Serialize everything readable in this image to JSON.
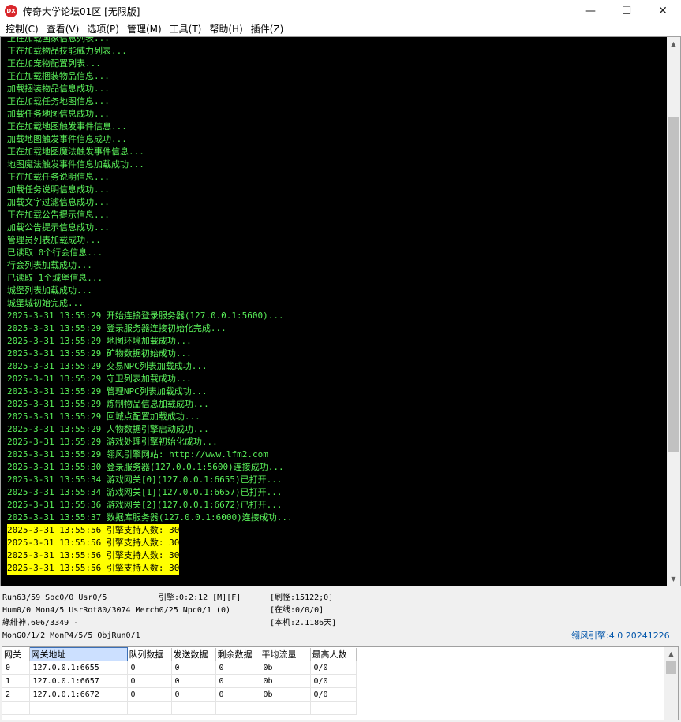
{
  "window": {
    "title": "传奇大学论坛01区 [无限版]",
    "icon_label": "DX",
    "minimize_glyph": "—",
    "maximize_glyph": "☐",
    "close_glyph": "✕"
  },
  "menu": [
    {
      "label": "控制(C)"
    },
    {
      "label": "查看(V)"
    },
    {
      "label": "选项(P)"
    },
    {
      "label": "管理(M)"
    },
    {
      "label": "工具(T)"
    },
    {
      "label": "帮助(H)"
    },
    {
      "label": "插件(Z)"
    }
  ],
  "console": {
    "text_color": "#5af25a",
    "highlight_color": "#ffff00",
    "scroll_position": 0.36,
    "lines": [
      {
        "text": "正在加载国家信息列表..."
      },
      {
        "text": "正在加载物品技能威力列表..."
      },
      {
        "text": "正在加宠物配置列表..."
      },
      {
        "text": "正在加载捆装物品信息..."
      },
      {
        "text": "加载捆装物品信息成功..."
      },
      {
        "text": "正在加载任务地图信息..."
      },
      {
        "text": "加载任务地图信息成功..."
      },
      {
        "text": "正在加载地图触发事件信息..."
      },
      {
        "text": "加载地图触发事件信息成功..."
      },
      {
        "text": "正在加载地图魔法触发事件信息..."
      },
      {
        "text": "地图魔法触发事件信息加载成功..."
      },
      {
        "text": "正在加载任务说明信息..."
      },
      {
        "text": "加载任务说明信息成功..."
      },
      {
        "text": "加载文字过滤信息成功..."
      },
      {
        "text": "正在加载公告提示信息..."
      },
      {
        "text": "加载公告提示信息成功..."
      },
      {
        "text": "管理员列表加载成功..."
      },
      {
        "text": "已读取 0个行会信息..."
      },
      {
        "text": "行会列表加载成功..."
      },
      {
        "text": "已读取 1个城堡信息..."
      },
      {
        "text": "城堡列表加载成功..."
      },
      {
        "text": "城堡城初始完成..."
      },
      {
        "text": "2025-3-31 13:55:29 开始连接登录服务器(127.0.0.1:5600)..."
      },
      {
        "text": "2025-3-31 13:55:29 登录服务器连接初始化完成..."
      },
      {
        "text": "2025-3-31 13:55:29 地图环境加载成功..."
      },
      {
        "text": "2025-3-31 13:55:29 矿物数据初始成功..."
      },
      {
        "text": "2025-3-31 13:55:29 交易NPC列表加载成功..."
      },
      {
        "text": "2025-3-31 13:55:29 守卫列表加载成功..."
      },
      {
        "text": "2025-3-31 13:55:29 管理NPC列表加载成功..."
      },
      {
        "text": "2025-3-31 13:55:29 炼制物品信息加载成功..."
      },
      {
        "text": "2025-3-31 13:55:29 回城点配置加载成功..."
      },
      {
        "text": "2025-3-31 13:55:29 人物数据引擎启动成功..."
      },
      {
        "text": "2025-3-31 13:55:29 游戏处理引擎初始化成功..."
      },
      {
        "text": "2025-3-31 13:55:29 翎风引擎网站: http://www.lfm2.com"
      },
      {
        "text": "2025-3-31 13:55:30 登录服务器(127.0.0.1:5600)连接成功..."
      },
      {
        "text": "2025-3-31 13:55:34 游戏网关[0](127.0.0.1:6655)已打开..."
      },
      {
        "text": "2025-3-31 13:55:34 游戏网关[1](127.0.0.1:6657)已打开..."
      },
      {
        "text": "2025-3-31 13:55:36 游戏网关[2](127.0.0.1:6672)已打开..."
      },
      {
        "text": "2025-3-31 13:55:37 数据库服务器(127.0.0.1:6000)连接成功..."
      },
      {
        "text": "2025-3-31 13:55:56 引擎支持人数: 30",
        "highlight": true
      },
      {
        "text": "2025-3-31 13:55:56 引擎支持人数: 30",
        "highlight": true
      },
      {
        "text": "2025-3-31 13:55:56 引擎支持人数: 30",
        "highlight": true
      },
      {
        "text": "2025-3-31 13:55:56 引擎支持人数: 30",
        "highlight": true
      }
    ]
  },
  "status": {
    "line1_left": "Run63/59 Soc0/0 Usr0/5",
    "engine": "引擎:0:2:12 [M][F]",
    "refresh": "[刷怪:15122;0]",
    "line2_left": "Hum0/0 Mon4/5 UsrRot80/3074 Merch0/25 Npc0/1 (0)",
    "online": "[在线:0/0/0]",
    "line3_left": "綠緋神,606/3349 -",
    "local": "[本机:2.1186天]",
    "line4_left": "MonG0/1/2 MonP4/5/5 ObjRun0/1",
    "version": "翎风引擎:4.0 20241226"
  },
  "gateway_table": {
    "columns": [
      "网关",
      "网关地址",
      "队列数据",
      "发送数据",
      "剩余数据",
      "平均流量",
      "最高人数"
    ],
    "selected_column": 1,
    "rows": [
      [
        "0",
        "127.0.0.1:6655",
        "0",
        "0",
        "0",
        "0b",
        "0/0"
      ],
      [
        "1",
        "127.0.0.1:6657",
        "0",
        "0",
        "0",
        "0b",
        "0/0"
      ],
      [
        "2",
        "127.0.0.1:6672",
        "0",
        "0",
        "0",
        "0b",
        "0/0"
      ]
    ]
  }
}
